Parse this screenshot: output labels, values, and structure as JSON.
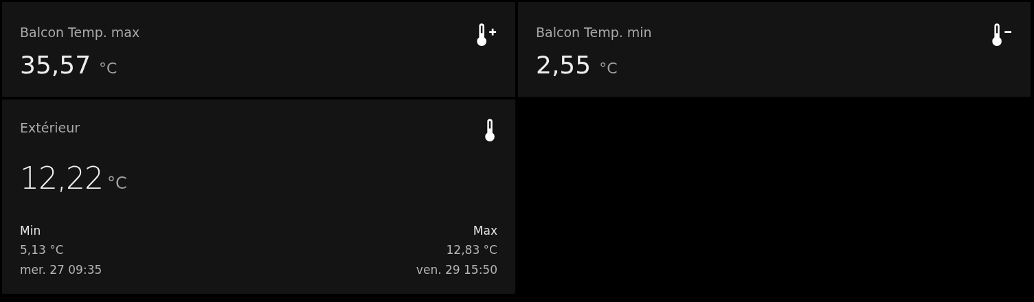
{
  "tiles": [
    {
      "kind": "simple",
      "title": "Balcon Temp. max",
      "value": "35,57",
      "unit": "°C"
    },
    {
      "kind": "simple",
      "title": "Balcon Temp. min",
      "value": "2,55",
      "unit": "°C"
    },
    {
      "kind": "detail",
      "title": "Extérieur",
      "value": "12,22",
      "unit": "°C",
      "min": {
        "label": "Min",
        "value": "5,13 °C",
        "time": "mer. 27 09:35"
      },
      "max": {
        "label": "Max",
        "value": "12,83 °C",
        "time": "ven. 29 15:50"
      }
    }
  ]
}
